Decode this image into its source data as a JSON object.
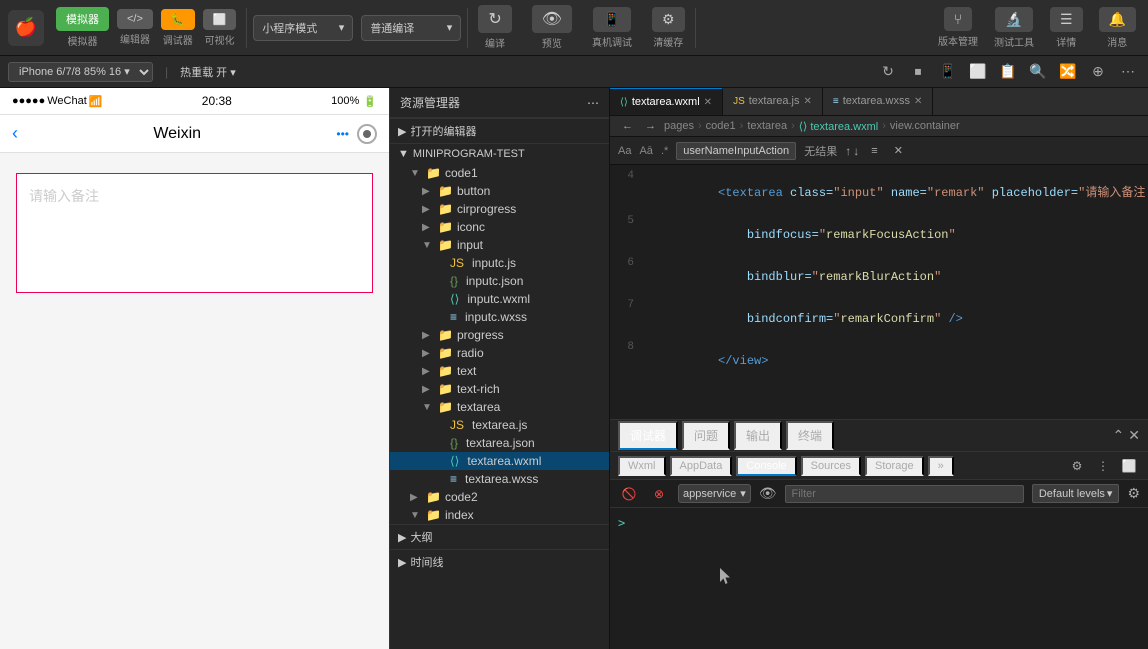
{
  "toolbar": {
    "logo": "🍎",
    "simulator_label": "模拟器",
    "editor_label": "编辑器",
    "debug_label": "调试器",
    "visual_label": "可视化",
    "mode_label": "小程序模式",
    "compile_label": "普通编译",
    "compile_icon": "▶",
    "refresh_icon": "↻",
    "preview_icon": "👁",
    "real_device_icon": "📱",
    "cache_icon": "⚙",
    "compile_btn": "编译",
    "preview_btn": "预览",
    "real_device_btn": "真机调试",
    "clear_cache_btn": "清缓存",
    "version_btn": "版本管理",
    "test_btn": "测试工具",
    "details_btn": "详情",
    "notification_btn": "消息"
  },
  "second_toolbar": {
    "device": "iPhone 6/7/8 85% 16 ▾",
    "hotreload": "热重载 开 ▾",
    "icons": [
      "↻",
      "⏹",
      "📱",
      "⬜",
      "⬛",
      "📋",
      "🔍",
      "🔀",
      "⊕",
      "🔧",
      "⋯"
    ]
  },
  "file_explorer": {
    "title": "资源管理器",
    "more_icon": "⋯",
    "open_editors": "打开的编辑器",
    "root": "MINIPROGRAM-TEST",
    "tree": [
      {
        "type": "folder",
        "name": "code1",
        "indent": 1,
        "expanded": true
      },
      {
        "type": "folder",
        "name": "button",
        "indent": 2
      },
      {
        "type": "folder",
        "name": "cirprogress",
        "indent": 2
      },
      {
        "type": "folder",
        "name": "iconc",
        "indent": 2
      },
      {
        "type": "folder",
        "name": "input",
        "indent": 2,
        "expanded": true
      },
      {
        "type": "file",
        "name": "inputc.js",
        "ext": "js",
        "indent": 3
      },
      {
        "type": "file",
        "name": "inputc.json",
        "ext": "json",
        "indent": 3
      },
      {
        "type": "file",
        "name": "inputc.wxml",
        "ext": "wxml",
        "indent": 3
      },
      {
        "type": "file",
        "name": "inputc.wxss",
        "ext": "wxss",
        "indent": 3
      },
      {
        "type": "folder",
        "name": "progress",
        "indent": 2
      },
      {
        "type": "folder",
        "name": "radio",
        "indent": 2
      },
      {
        "type": "folder",
        "name": "text",
        "indent": 2
      },
      {
        "type": "folder",
        "name": "text-rich",
        "indent": 2
      },
      {
        "type": "folder",
        "name": "textarea",
        "indent": 2,
        "expanded": true
      },
      {
        "type": "file",
        "name": "textarea.js",
        "ext": "js",
        "indent": 3
      },
      {
        "type": "file",
        "name": "textarea.json",
        "ext": "json",
        "indent": 3
      },
      {
        "type": "file",
        "name": "textarea.wxml",
        "ext": "wxml",
        "indent": 3,
        "selected": true
      },
      {
        "type": "file",
        "name": "textarea.wxss",
        "ext": "wxss",
        "indent": 3
      },
      {
        "type": "folder",
        "name": "code2",
        "indent": 1
      },
      {
        "type": "folder",
        "name": "index",
        "indent": 1,
        "expanded": true
      }
    ],
    "outline_label": "大纲",
    "timeline_label": "时间线"
  },
  "editor": {
    "tabs": [
      {
        "name": "textarea.wxml",
        "active": true,
        "ext": "wxml"
      },
      {
        "name": "textarea.js",
        "active": false,
        "ext": "js"
      },
      {
        "name": "textarea.wxss",
        "active": false,
        "ext": "wxss"
      }
    ],
    "breadcrumb": [
      "pages",
      "code1",
      "textarea",
      "textarea.wxml",
      "view.container"
    ],
    "search": {
      "action": "userNameInputAction",
      "placeholder": "无结果",
      "nav_up": "↑",
      "nav_down": "↓",
      "menu": "≡",
      "close": "✕"
    },
    "lines": [
      {
        "num": 4,
        "content": "<textarea class=\"input\" name=\"remark\" placeholder=\"请输入备注"
      }
    ],
    "line5": "    bindfocus=\"remarkFocusAction\"",
    "line6": "    bindblur=\"remarkBlurAction\"",
    "line7": "    bindconfirm=\"remarkConfirm\" />",
    "line8": "</view>"
  },
  "devtools": {
    "tabs": [
      "调试器",
      "问题",
      "输出",
      "终端"
    ],
    "active_tab": "Console",
    "subtabs": [
      "Wxml",
      "AppData",
      "Console",
      "Sources",
      "Storage"
    ],
    "active_subtab": "Console",
    "more_tabs": "»",
    "appservice": "appservice",
    "filter_placeholder": "Filter",
    "default_levels": "Default levels",
    "console_prompt": ">"
  },
  "phone": {
    "time": "20:38",
    "signal": "●●●●●",
    "wifi": "WiFi",
    "network": "WeChat",
    "battery": "100%",
    "nav_title": "Weixin",
    "nav_back": "‹",
    "nav_dots": "•••",
    "textarea_placeholder": "请输入备注"
  }
}
